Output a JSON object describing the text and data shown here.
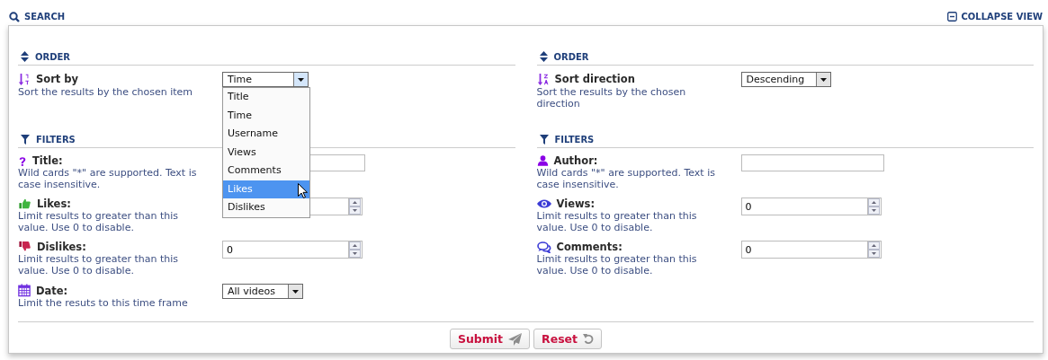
{
  "header": {
    "title": "SEARCH",
    "collapse": "COLLAPSE VIEW"
  },
  "columns": [
    {
      "order": {
        "heading": "ORDER",
        "label": "Sort by",
        "help": "Sort the results by the chosen item",
        "select": {
          "value": "Time",
          "expanded": true,
          "options": [
            {
              "label": "Title",
              "highlighted": false
            },
            {
              "label": "Time",
              "highlighted": false
            },
            {
              "label": "Username",
              "highlighted": false
            },
            {
              "label": "Views",
              "highlighted": false
            },
            {
              "label": "Comments",
              "highlighted": false
            },
            {
              "label": "Likes",
              "highlighted": true
            },
            {
              "label": "Dislikes",
              "highlighted": false
            }
          ]
        }
      },
      "filters": {
        "heading": "FILTERS",
        "fields": [
          {
            "kind": "text",
            "label": "Title:",
            "help": "Wild cards \"*\" are supported. Text is case insensitive."
          },
          {
            "kind": "number",
            "label": "Likes:",
            "help": "Limit results to greater than this value. Use 0 to disable."
          },
          {
            "kind": "number",
            "label": "Dislikes:",
            "help": "Limit results to greater than this value. Use 0 to disable.",
            "value": "0"
          },
          {
            "kind": "select",
            "label": "Date:",
            "help": "Limit the resuts to this time frame",
            "value": "All videos"
          }
        ]
      }
    },
    {
      "order": {
        "heading": "ORDER",
        "label": "Sort direction",
        "help": "Sort the results by the chosen direction",
        "select": {
          "value": "Descending",
          "expanded": false
        }
      },
      "filters": {
        "heading": "FILTERS",
        "fields": [
          {
            "kind": "text",
            "label": "Author:",
            "help": "Wild cards \"*\" are supported. Text is case insensitive."
          },
          {
            "kind": "number",
            "label": "Views:",
            "help": "Limit results to greater than this value. Use 0 to disable.",
            "value": "0"
          },
          {
            "kind": "number",
            "label": "Comments:",
            "help": "Limit results to greater than this value. Use 0 to disable.",
            "value": "0"
          }
        ]
      }
    }
  ],
  "buttons": [
    {
      "kind": "submit",
      "label": "Submit"
    },
    {
      "kind": "reset",
      "label": "Reset"
    }
  ]
}
